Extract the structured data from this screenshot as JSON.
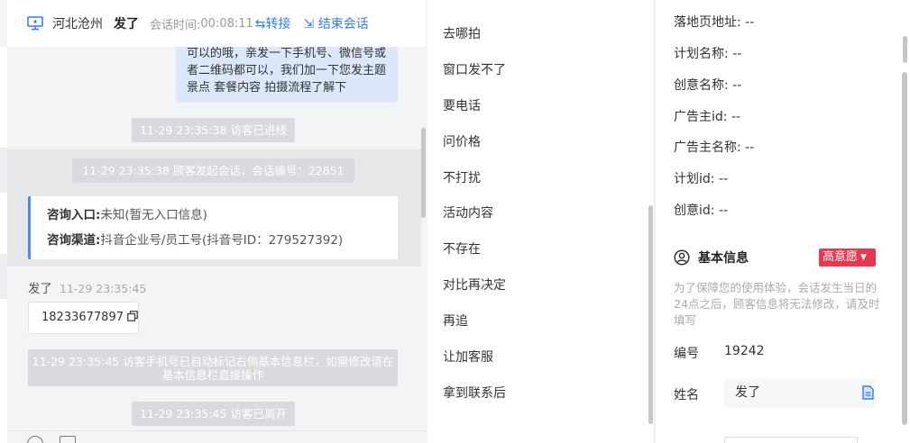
{
  "header": {
    "region": "河北沧州",
    "visitor_name": "发了",
    "timer_label": "会话时间:",
    "timer_value": "00:08:11",
    "transfer_label": "转接",
    "end_label": "结束会话"
  },
  "messages": {
    "outgoing_text": "可以的哦，亲发一下手机号、微信号或者二维码都可以，我们加一下您发主题景点 套餐内容 拍摄流程了解下",
    "sys_visitor_entered": "11-29 23:35:38 访客已进线",
    "sys_session_started": "11-29 23:35:38 顾客发起会话，会话编号：22851",
    "entry_label": "咨询入口:",
    "entry_value": "未知(暂无入口信息)",
    "channel_label": "咨询渠道:",
    "channel_value": "抖音企业号/员工号(抖音号ID：279527392)",
    "sender_name": "发了",
    "sender_time": "11-29 23:35:45",
    "phone_value": "18233677897",
    "sys_phone_notice": "11-29 23:35:45 访客手机号已自动标记右侧基本信息栏，如需修改请在基本信息栏直接操作",
    "sys_visitor_left": "11-29 23:35:45 访客已离开"
  },
  "quick_replies": [
    "去哪拍",
    "窗口发不了",
    "要电话",
    "问价格",
    "不打扰",
    "活动内容",
    "不存在",
    "对比再决定",
    "再追",
    "让加客服",
    "拿到联系后"
  ],
  "ad_info": [
    {
      "label": "落地页地址:",
      "value": "--"
    },
    {
      "label": "计划名称:",
      "value": "--"
    },
    {
      "label": "创意名称:",
      "value": "--"
    },
    {
      "label": "广告主id:",
      "value": "--"
    },
    {
      "label": "广告主名称:",
      "value": "--"
    },
    {
      "label": "计划id:",
      "value": "--"
    },
    {
      "label": "创意id:",
      "value": "--"
    }
  ],
  "basic_info": {
    "title": "基本信息",
    "intent_badge": "高意愿",
    "hint": "为了保障您的使用体验，会话发生当日的24点之后，顾客信息将无法修改，请及时填写",
    "id_label": "编号",
    "id_value": "19242",
    "name_label": "姓名",
    "name_value": "发了"
  },
  "colors": {
    "accent_blue": "#2f7df6",
    "badge_red": "#e8384f",
    "outgoing_bubble": "#dbe7fb",
    "system_tag": "#d9dadd"
  },
  "icons": [
    "monitor-icon",
    "transfer-icon",
    "exit-icon",
    "copy-icon",
    "user-circle-icon",
    "document-icon",
    "caret-down-icon"
  ]
}
